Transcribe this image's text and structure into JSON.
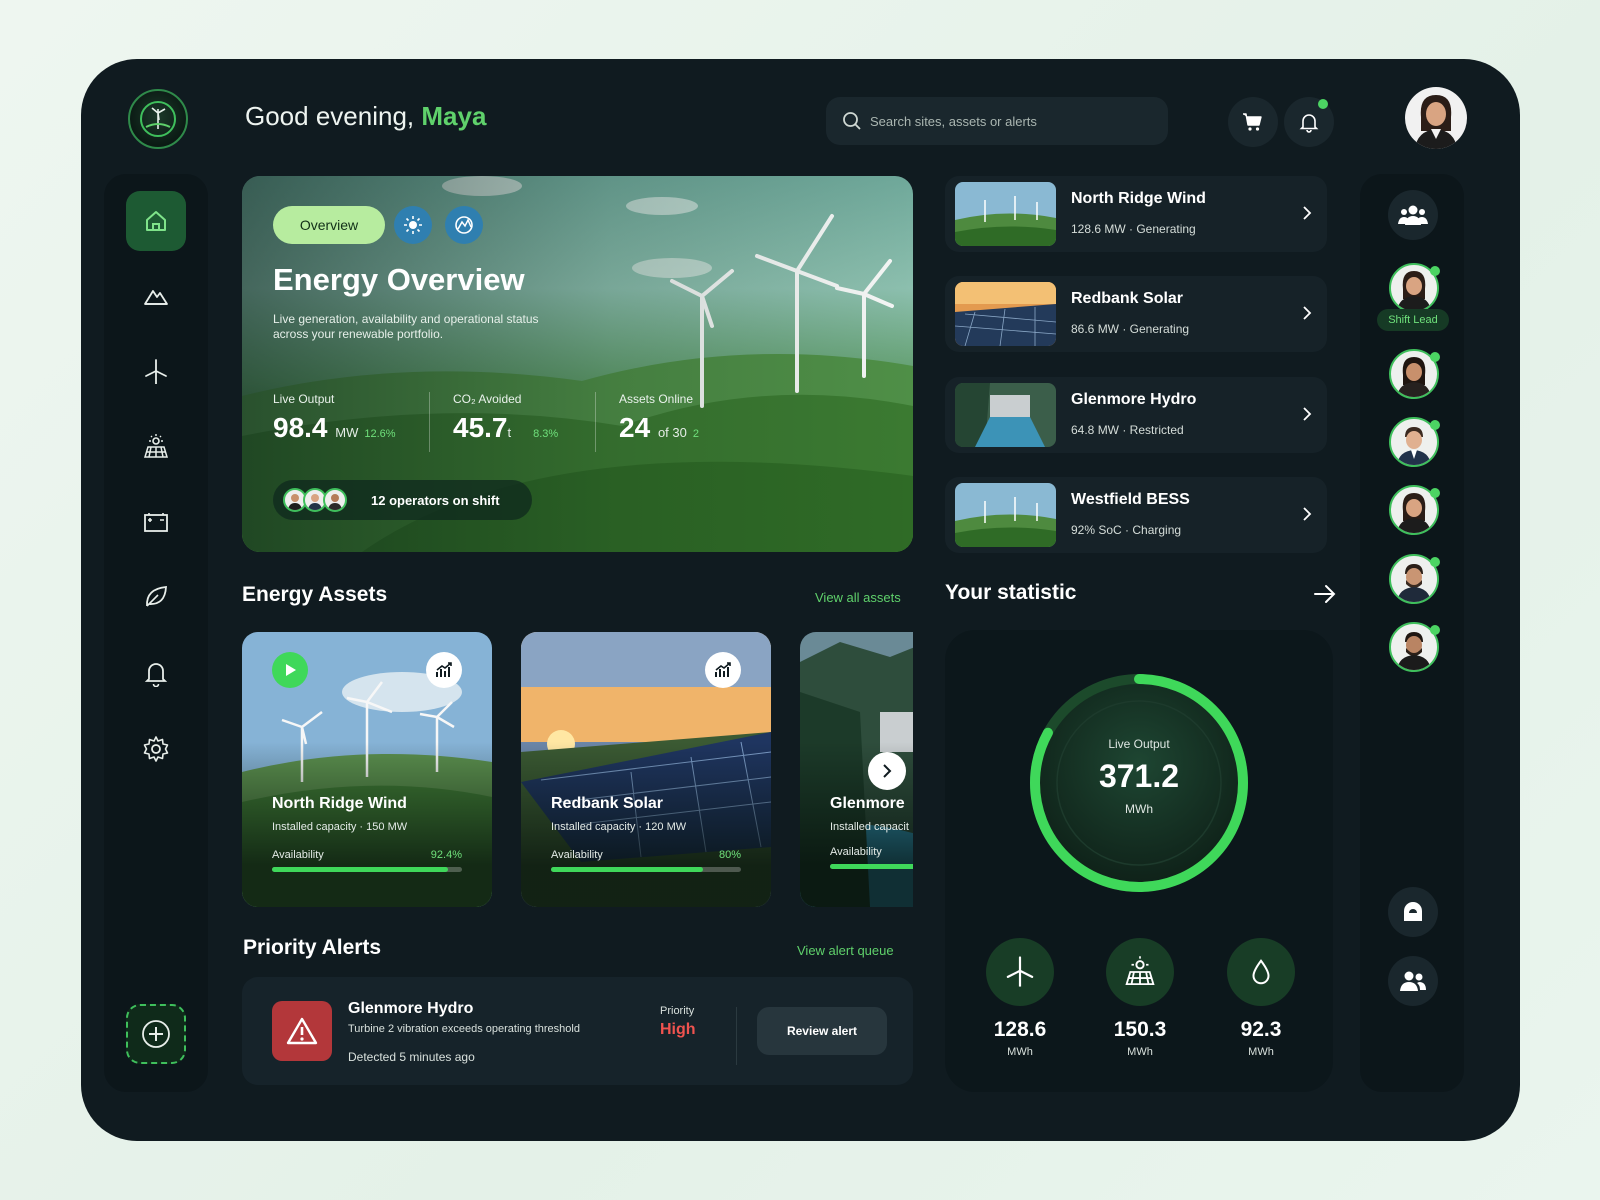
{
  "header": {
    "greeting": "Good evening,",
    "user_name": "Maya",
    "search_placeholder": "Search sites, assets or alerts"
  },
  "sidebar": {
    "items": [
      {
        "icon": "home-icon",
        "active": true
      },
      {
        "icon": "mountain-icon"
      },
      {
        "icon": "wind-turbine-icon"
      },
      {
        "icon": "solar-panel-icon"
      },
      {
        "icon": "battery-icon"
      },
      {
        "icon": "leaf-icon"
      },
      {
        "icon": "bell-icon"
      },
      {
        "icon": "gear-icon"
      }
    ]
  },
  "hero": {
    "pill": "Overview",
    "title": "Energy Overview",
    "subtitle": "Live generation, availability and operational status across your renewable portfolio.",
    "stats": [
      {
        "label": "Live Output",
        "value": "98.4",
        "unit": "MW",
        "change": "12.6%"
      },
      {
        "label": "CO₂ Avoided",
        "value": "45.7",
        "unit": "t",
        "change": "8.3%"
      },
      {
        "label": "Assets Online",
        "value": "24",
        "unit": "of 30",
        "change": "2"
      }
    ],
    "operators": "12 operators on shift"
  },
  "sites": [
    {
      "name": "North Ridge Wind",
      "status": "128.6 MW · Generating"
    },
    {
      "name": "Redbank Solar",
      "status": "86.6 MW · Generating"
    },
    {
      "name": "Glenmore Hydro",
      "status": "64.8 MW · Restricted"
    },
    {
      "name": "Westfield BESS",
      "status": "92% SoC · Charging"
    }
  ],
  "assets": {
    "title": "Energy Assets",
    "link": "View all assets",
    "cards": [
      {
        "name": "North Ridge Wind",
        "capacity": "Installed capacity · 150 MW",
        "avail_label": "Availability",
        "avail_value": "92.4%",
        "avail": 0.924
      },
      {
        "name": "Redbank Solar",
        "capacity": "Installed capacity · 120 MW",
        "avail_label": "Availability",
        "avail_value": "80%",
        "avail": 0.8
      },
      {
        "name": "Glenmore",
        "capacity": "Installed capacit",
        "avail_label": "Availability",
        "avail_value": "",
        "avail": 0.95
      }
    ]
  },
  "alerts": {
    "title": "Priority Alerts",
    "link": "View alert queue",
    "item": {
      "site": "Glenmore Hydro",
      "message": "Turbine 2 vibration exceeds operating threshold",
      "detected": "Detected 5 minutes ago",
      "priority_label": "Priority",
      "priority_value": "High",
      "action": "Review alert"
    }
  },
  "statistic": {
    "title": "Your statistic",
    "gauge_label": "Live Output",
    "gauge_value": "371.2",
    "gauge_unit": "MWh",
    "gauge_fill": 0.83,
    "breakdown": [
      {
        "icon": "wind-turbine-icon",
        "value": "128.6",
        "unit": "MWh"
      },
      {
        "icon": "solar-panel-icon",
        "value": "150.3",
        "unit": "MWh"
      },
      {
        "icon": "water-drop-icon",
        "value": "92.3",
        "unit": "MWh"
      }
    ]
  },
  "rail": {
    "lead_label": "Shift Lead"
  },
  "colors": {
    "accent": "#5fd16b",
    "panel": "#101b20",
    "alert_red": "#b3373a"
  }
}
